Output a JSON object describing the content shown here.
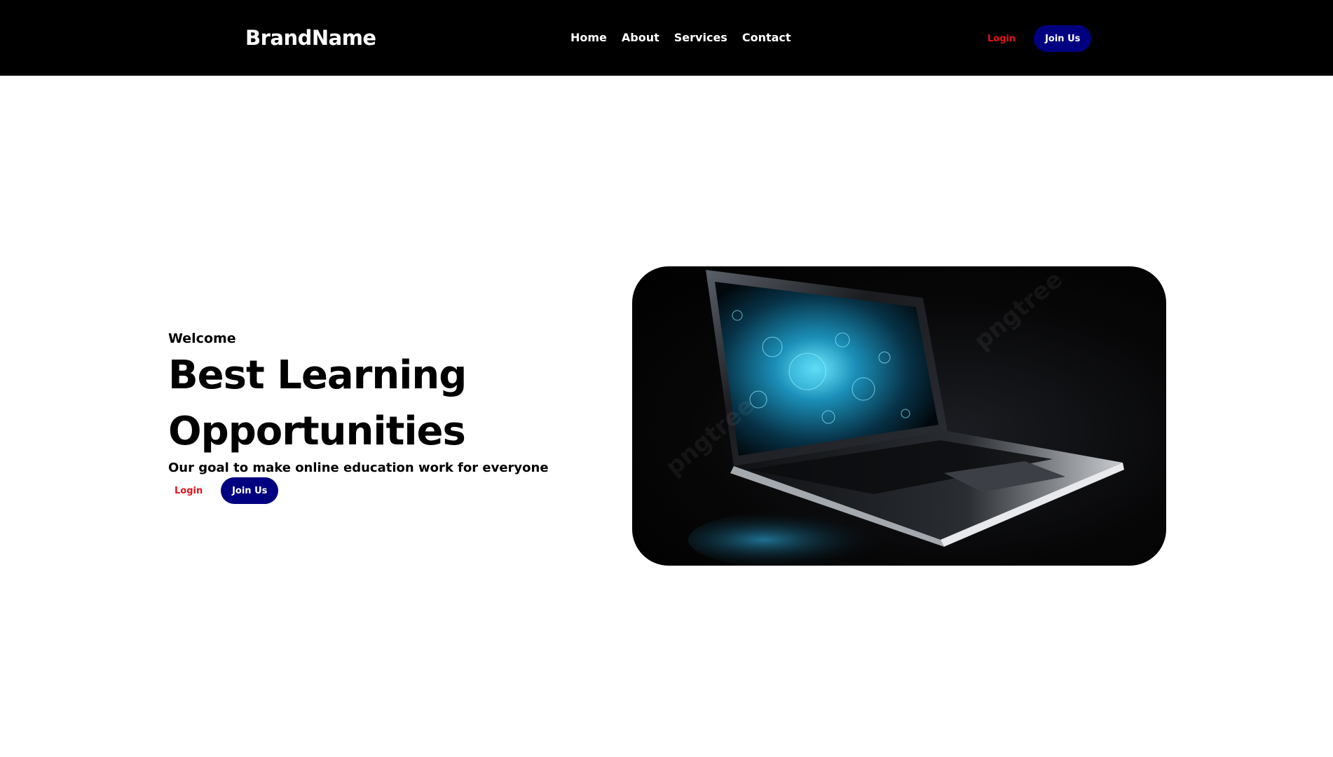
{
  "header": {
    "brand": "BrandName",
    "nav": [
      "Home",
      "About",
      "Services",
      "Contact"
    ],
    "login_label": "Login",
    "join_label": "Join Us"
  },
  "hero": {
    "welcome": "Welcome",
    "headline_line1": "Best Learning",
    "headline_line2": "Opportunities",
    "subtitle": "Our goal to make online education work for everyone",
    "login_label": "Login",
    "join_label": "Join Us",
    "image": "laptop-glowing-screen-image",
    "watermark": "pngtree"
  },
  "colors": {
    "navbar_bg": "#000000",
    "accent_red": "#e3131b",
    "button_navy": "#010080",
    "page_bg": "#ffffff"
  }
}
